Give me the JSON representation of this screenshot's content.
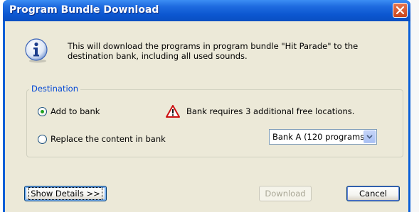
{
  "window": {
    "title": "Program Bundle Download"
  },
  "message": "This will download the programs in program bundle \"Hit Parade\" to the destination bank, including all used sounds.",
  "destination": {
    "legend": "Destination",
    "options": [
      {
        "label": "Add to bank",
        "checked": true
      },
      {
        "label": "Replace the content in bank",
        "checked": false
      }
    ],
    "warning": "Bank requires 3 additional free locations.",
    "bank_select": "Bank A (120 programs)"
  },
  "buttons": {
    "details": "Show Details >>",
    "download": "Download",
    "cancel": "Cancel"
  },
  "colors": {
    "title_bar": "#0a56d0",
    "client": "#ece9d8",
    "legend": "#0046d5",
    "close": "#d9572e"
  }
}
